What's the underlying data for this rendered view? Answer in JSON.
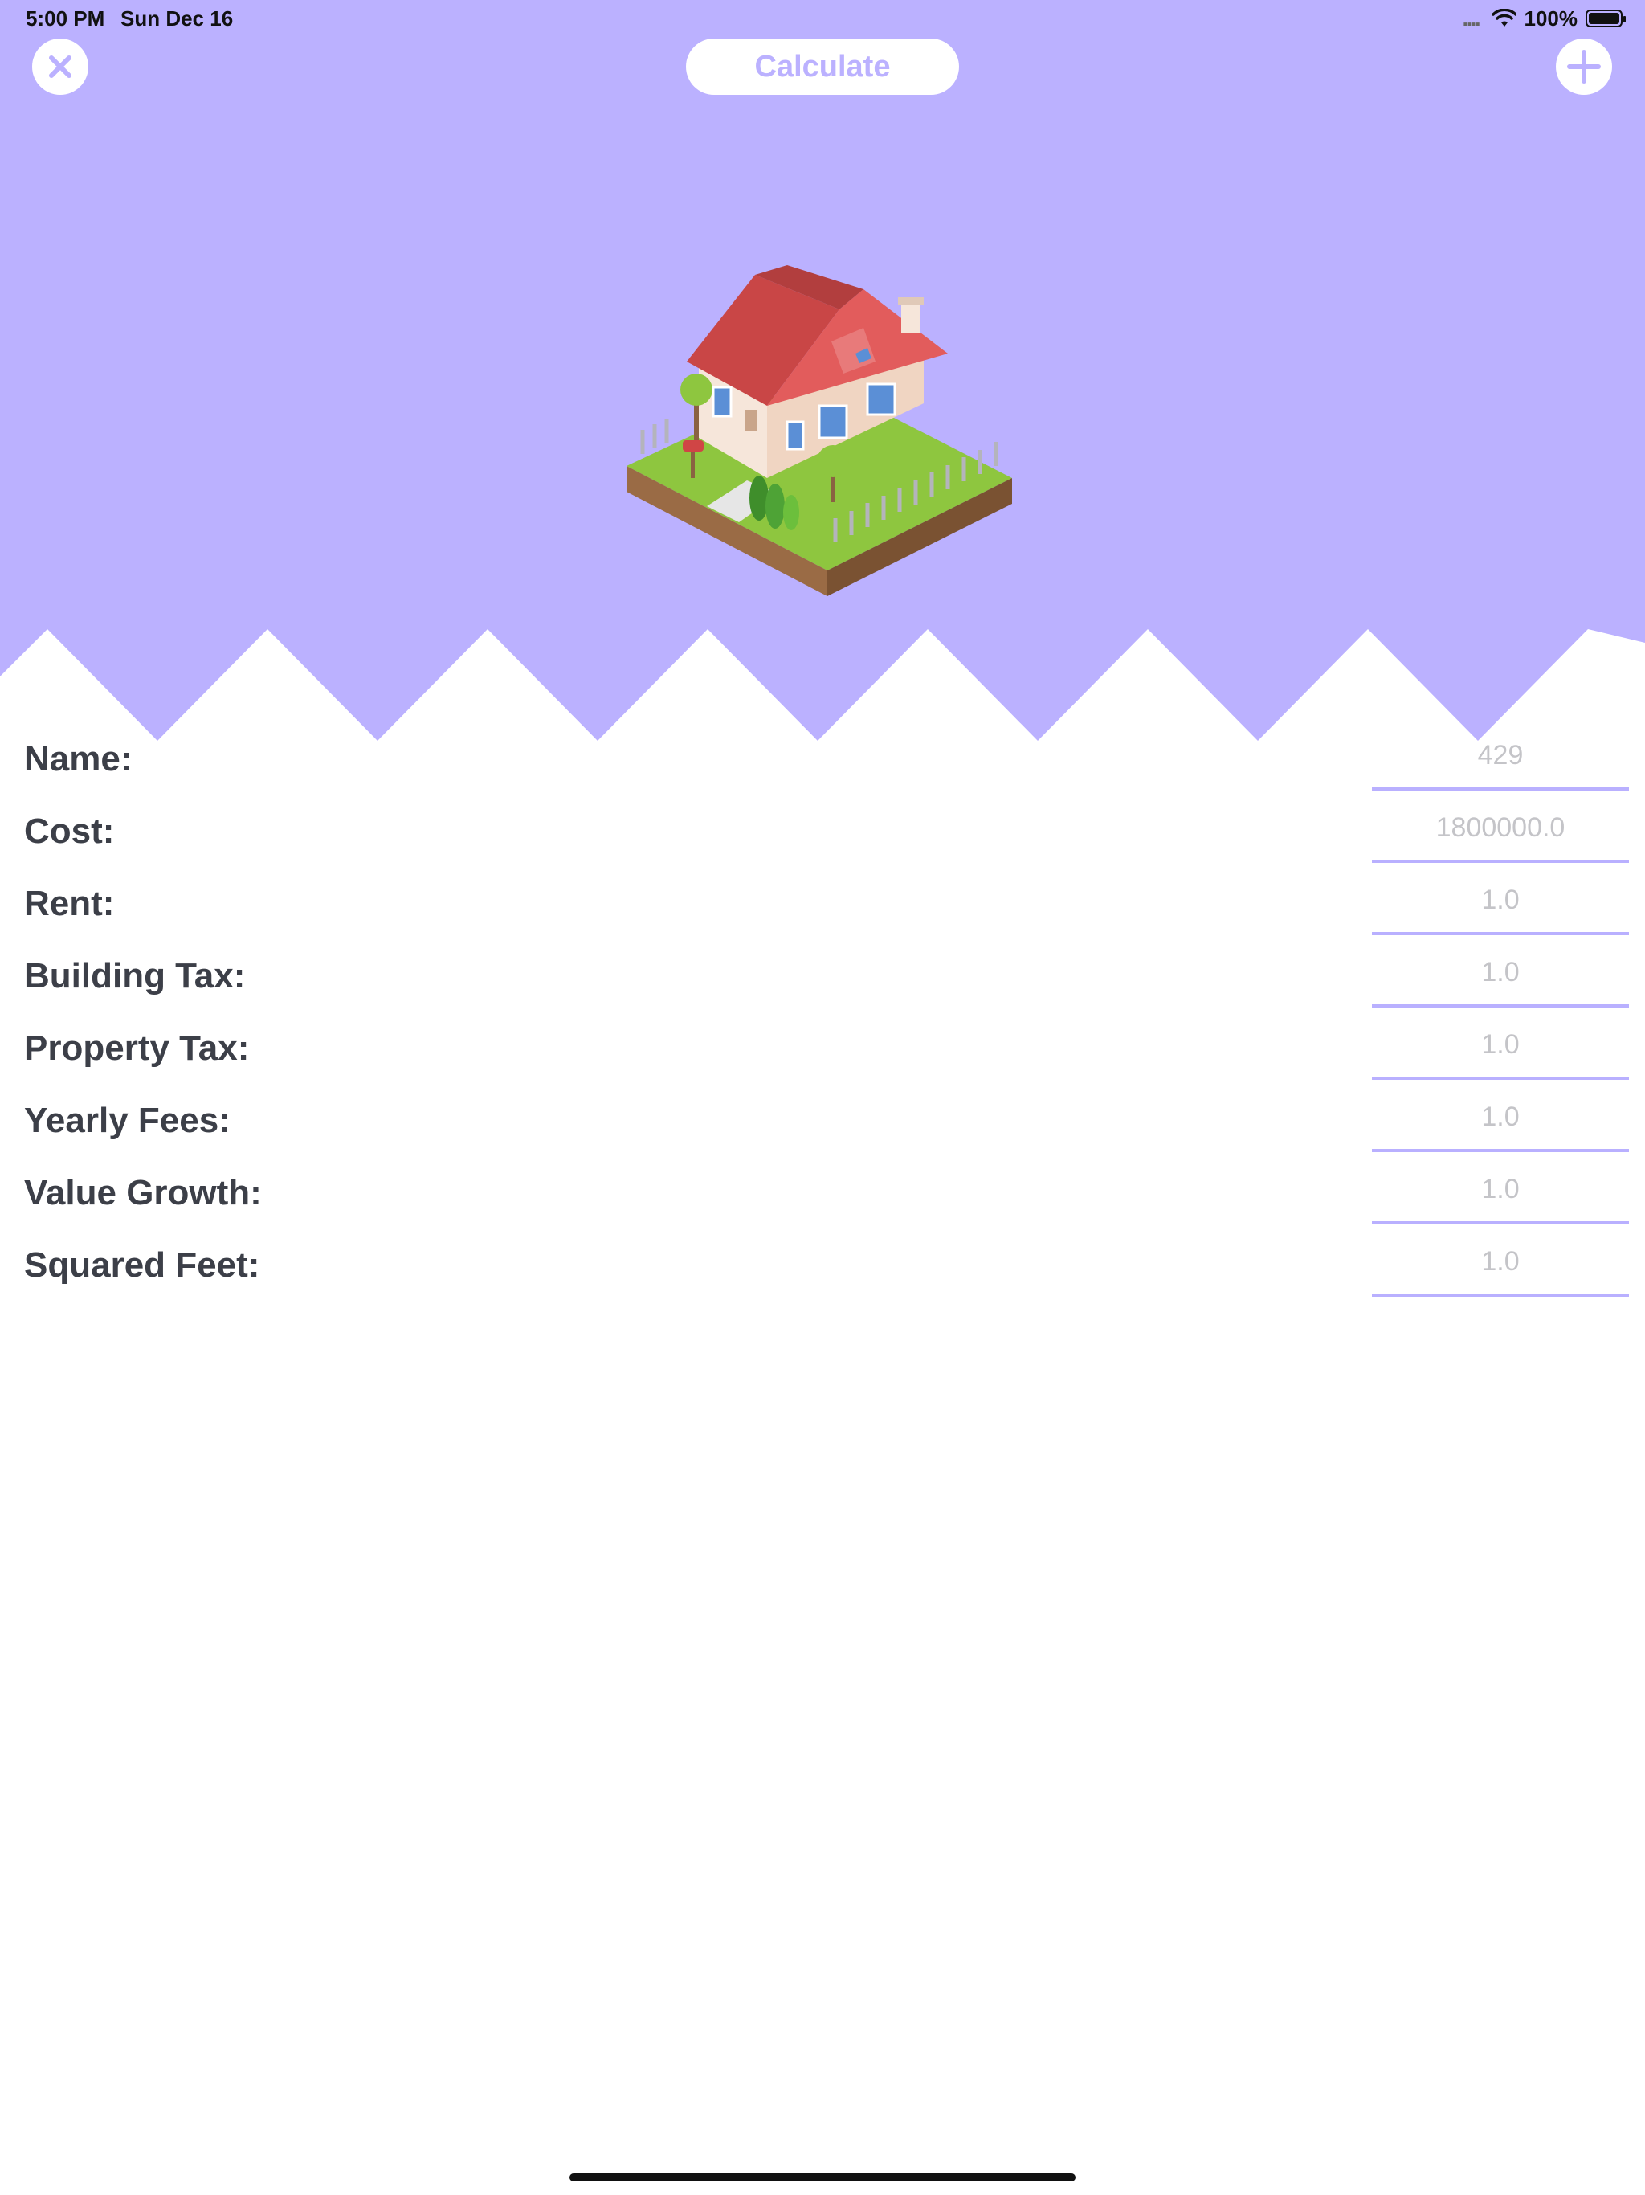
{
  "status_bar": {
    "time": "5:00 PM",
    "date": "Sun Dec 16",
    "signal": "....",
    "battery_percent": "100%",
    "icons": [
      "wifi-icon",
      "battery-icon"
    ]
  },
  "toolbar": {
    "close_icon": "close-x-icon",
    "calculate_label": "Calculate",
    "add_icon": "plus-icon"
  },
  "header": {
    "background_color": "#bbb1ff",
    "illustration": "isometric-house-illustration"
  },
  "form": {
    "fields": [
      {
        "label": "Name:",
        "value": "429"
      },
      {
        "label": "Cost:",
        "value": "1800000.0"
      },
      {
        "label": "Rent:",
        "value": "1.0"
      },
      {
        "label": "Building Tax:",
        "value": "1.0"
      },
      {
        "label": "Property Tax:",
        "value": "1.0"
      },
      {
        "label": "Yearly Fees:",
        "value": "1.0"
      },
      {
        "label": "Value Growth:",
        "value": "1.0"
      },
      {
        "label": "Squared Feet:",
        "value": "1.0"
      }
    ]
  },
  "colors": {
    "accent": "#bbb1ff",
    "label_text": "#3c3f48",
    "value_text": "#c4c4c8"
  }
}
